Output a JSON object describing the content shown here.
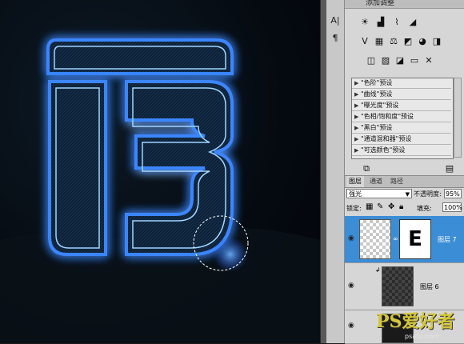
{
  "adjustments": {
    "header_title": "添加调整",
    "presets": [
      "\"色阶\"预设",
      "\"曲线\"预设",
      "\"曝光度\"预设",
      "\"色相/饱和度\"预设",
      "\"黑白\"预设",
      "\"通道混和器\"预设",
      "\"可选颜色\"预设"
    ]
  },
  "layers_panel": {
    "tabs": [
      "图层",
      "通道",
      "路径"
    ],
    "blend_mode": "强光",
    "opacity_label": "不透明度:",
    "opacity_value": "95%",
    "lock_label": "锁定:",
    "fill_label": "填充:",
    "fill_value": "100%",
    "layers": [
      {
        "name": "图层 7",
        "selected": true
      },
      {
        "name": "图层 6",
        "selected": false
      }
    ]
  },
  "watermark": {
    "main": "PS爱好者",
    "sub": "psahz.com"
  },
  "colors": {
    "neon_blue": "#2f7dff",
    "neon_core": "#9fd4ff",
    "selected_layer": "#3b8dd6"
  }
}
